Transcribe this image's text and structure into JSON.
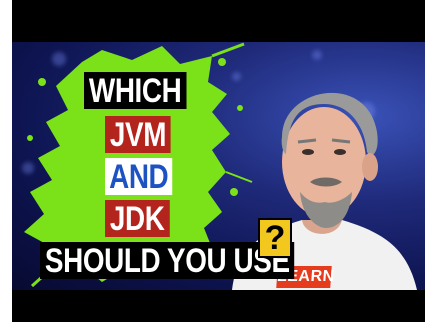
{
  "thumbnail": {
    "line1": "WHICH",
    "line2": "JVM",
    "line3": "AND",
    "line4": "JDK",
    "line5": "SHOULD YOU USE",
    "qmark": "?",
    "shirt_text": "LEARN"
  },
  "colors": {
    "letterbox": "#000000",
    "splash_green": "#7be21a",
    "jvm_box": "#b3241c",
    "and_text": "#1c52c2",
    "qmark_box": "#f2c81e",
    "shirt_badge": "#e53c1e"
  }
}
